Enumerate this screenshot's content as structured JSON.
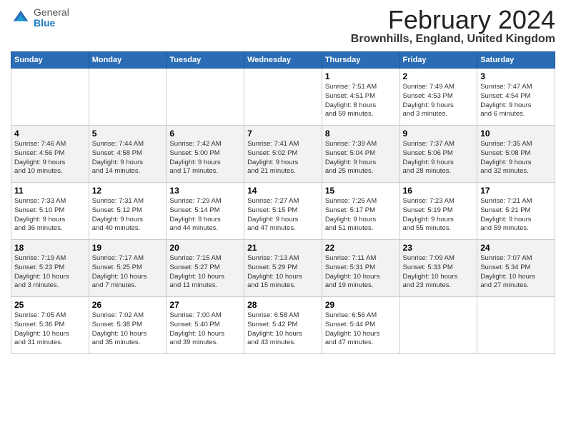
{
  "logo": {
    "general": "General",
    "blue": "Blue"
  },
  "title": "February 2024",
  "location": "Brownhills, England, United Kingdom",
  "days_of_week": [
    "Sunday",
    "Monday",
    "Tuesday",
    "Wednesday",
    "Thursday",
    "Friday",
    "Saturday"
  ],
  "weeks": [
    [
      {
        "day": "",
        "info": ""
      },
      {
        "day": "",
        "info": ""
      },
      {
        "day": "",
        "info": ""
      },
      {
        "day": "",
        "info": ""
      },
      {
        "day": "1",
        "info": "Sunrise: 7:51 AM\nSunset: 4:51 PM\nDaylight: 8 hours\nand 59 minutes."
      },
      {
        "day": "2",
        "info": "Sunrise: 7:49 AM\nSunset: 4:53 PM\nDaylight: 9 hours\nand 3 minutes."
      },
      {
        "day": "3",
        "info": "Sunrise: 7:47 AM\nSunset: 4:54 PM\nDaylight: 9 hours\nand 6 minutes."
      }
    ],
    [
      {
        "day": "4",
        "info": "Sunrise: 7:46 AM\nSunset: 4:56 PM\nDaylight: 9 hours\nand 10 minutes."
      },
      {
        "day": "5",
        "info": "Sunrise: 7:44 AM\nSunset: 4:58 PM\nDaylight: 9 hours\nand 14 minutes."
      },
      {
        "day": "6",
        "info": "Sunrise: 7:42 AM\nSunset: 5:00 PM\nDaylight: 9 hours\nand 17 minutes."
      },
      {
        "day": "7",
        "info": "Sunrise: 7:41 AM\nSunset: 5:02 PM\nDaylight: 9 hours\nand 21 minutes."
      },
      {
        "day": "8",
        "info": "Sunrise: 7:39 AM\nSunset: 5:04 PM\nDaylight: 9 hours\nand 25 minutes."
      },
      {
        "day": "9",
        "info": "Sunrise: 7:37 AM\nSunset: 5:06 PM\nDaylight: 9 hours\nand 28 minutes."
      },
      {
        "day": "10",
        "info": "Sunrise: 7:35 AM\nSunset: 5:08 PM\nDaylight: 9 hours\nand 32 minutes."
      }
    ],
    [
      {
        "day": "11",
        "info": "Sunrise: 7:33 AM\nSunset: 5:10 PM\nDaylight: 9 hours\nand 36 minutes."
      },
      {
        "day": "12",
        "info": "Sunrise: 7:31 AM\nSunset: 5:12 PM\nDaylight: 9 hours\nand 40 minutes."
      },
      {
        "day": "13",
        "info": "Sunrise: 7:29 AM\nSunset: 5:14 PM\nDaylight: 9 hours\nand 44 minutes."
      },
      {
        "day": "14",
        "info": "Sunrise: 7:27 AM\nSunset: 5:15 PM\nDaylight: 9 hours\nand 47 minutes."
      },
      {
        "day": "15",
        "info": "Sunrise: 7:25 AM\nSunset: 5:17 PM\nDaylight: 9 hours\nand 51 minutes."
      },
      {
        "day": "16",
        "info": "Sunrise: 7:23 AM\nSunset: 5:19 PM\nDaylight: 9 hours\nand 55 minutes."
      },
      {
        "day": "17",
        "info": "Sunrise: 7:21 AM\nSunset: 5:21 PM\nDaylight: 9 hours\nand 59 minutes."
      }
    ],
    [
      {
        "day": "18",
        "info": "Sunrise: 7:19 AM\nSunset: 5:23 PM\nDaylight: 10 hours\nand 3 minutes."
      },
      {
        "day": "19",
        "info": "Sunrise: 7:17 AM\nSunset: 5:25 PM\nDaylight: 10 hours\nand 7 minutes."
      },
      {
        "day": "20",
        "info": "Sunrise: 7:15 AM\nSunset: 5:27 PM\nDaylight: 10 hours\nand 11 minutes."
      },
      {
        "day": "21",
        "info": "Sunrise: 7:13 AM\nSunset: 5:29 PM\nDaylight: 10 hours\nand 15 minutes."
      },
      {
        "day": "22",
        "info": "Sunrise: 7:11 AM\nSunset: 5:31 PM\nDaylight: 10 hours\nand 19 minutes."
      },
      {
        "day": "23",
        "info": "Sunrise: 7:09 AM\nSunset: 5:33 PM\nDaylight: 10 hours\nand 23 minutes."
      },
      {
        "day": "24",
        "info": "Sunrise: 7:07 AM\nSunset: 5:34 PM\nDaylight: 10 hours\nand 27 minutes."
      }
    ],
    [
      {
        "day": "25",
        "info": "Sunrise: 7:05 AM\nSunset: 5:36 PM\nDaylight: 10 hours\nand 31 minutes."
      },
      {
        "day": "26",
        "info": "Sunrise: 7:02 AM\nSunset: 5:38 PM\nDaylight: 10 hours\nand 35 minutes."
      },
      {
        "day": "27",
        "info": "Sunrise: 7:00 AM\nSunset: 5:40 PM\nDaylight: 10 hours\nand 39 minutes."
      },
      {
        "day": "28",
        "info": "Sunrise: 6:58 AM\nSunset: 5:42 PM\nDaylight: 10 hours\nand 43 minutes."
      },
      {
        "day": "29",
        "info": "Sunrise: 6:56 AM\nSunset: 5:44 PM\nDaylight: 10 hours\nand 47 minutes."
      },
      {
        "day": "",
        "info": ""
      },
      {
        "day": "",
        "info": ""
      }
    ]
  ]
}
